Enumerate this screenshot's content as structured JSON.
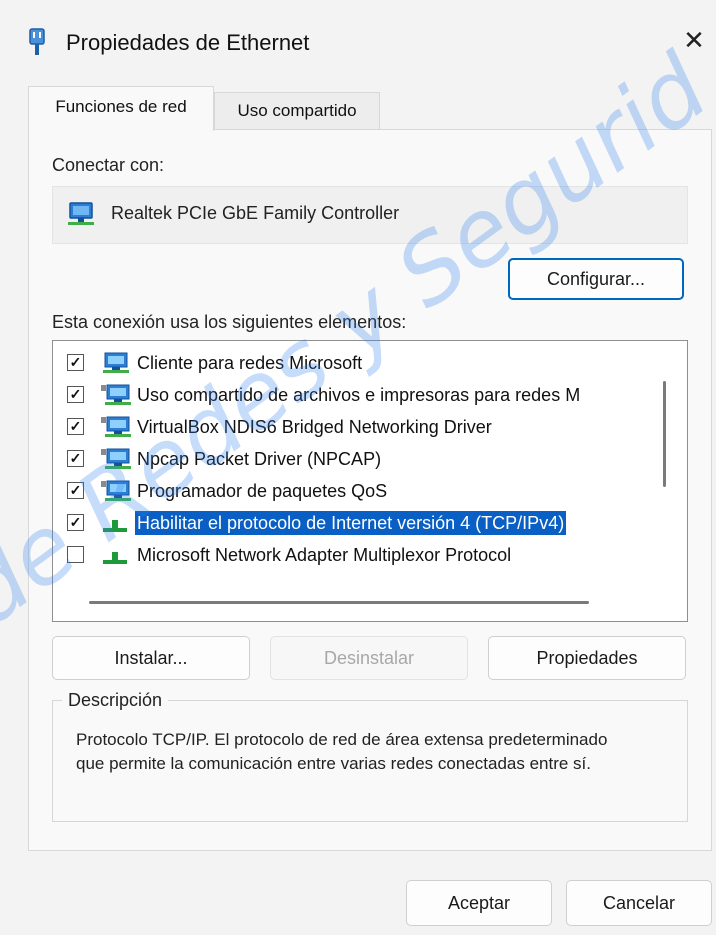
{
  "window": {
    "title": "Propiedades de Ethernet",
    "close_glyph": "✕"
  },
  "tabs": [
    {
      "label": "Funciones de red",
      "active": true
    },
    {
      "label": "Uso compartido",
      "active": false
    }
  ],
  "connect": {
    "label": "Conectar con:",
    "device_name": "Realtek PCIe GbE Family Controller",
    "device_icon": "network-adapter-icon"
  },
  "configure_button": "Configurar...",
  "items_label": "Esta conexión usa los siguientes elementos:",
  "items": [
    {
      "label": "Cliente para redes Microsoft",
      "checked": true,
      "icon": "network-client-icon",
      "selected": false
    },
    {
      "label": "Uso compartido de archivos e impresoras para redes M",
      "checked": true,
      "icon": "network-service-icon",
      "selected": false
    },
    {
      "label": "VirtualBox NDIS6 Bridged Networking Driver",
      "checked": true,
      "icon": "network-service-icon",
      "selected": false
    },
    {
      "label": "Npcap Packet Driver (NPCAP)",
      "checked": true,
      "icon": "network-service-icon",
      "selected": false
    },
    {
      "label": "Programador de paquetes QoS",
      "checked": true,
      "icon": "network-service-icon",
      "selected": false
    },
    {
      "label": "Habilitar el protocolo de Internet versión 4 (TCP/IPv4)",
      "checked": true,
      "icon": "protocol-icon",
      "selected": true
    },
    {
      "label": "Microsoft Network Adapter Multiplexor Protocol",
      "checked": false,
      "icon": "protocol-icon",
      "selected": false
    }
  ],
  "buttons": {
    "install": "Instalar...",
    "uninstall": "Desinstalar",
    "properties": "Propiedades"
  },
  "description": {
    "legend": "Descripción",
    "text": "Protocolo TCP/IP. El protocolo de red de área extensa predeterminado que permite la comunicación entre varias redes conectadas entre sí."
  },
  "footer": {
    "ok": "Aceptar",
    "cancel": "Cancelar"
  },
  "watermark": "de Redes y Segurid",
  "colors": {
    "accent": "#0067c0",
    "selection": "#0a5fc4",
    "watermark": "#3282f0"
  }
}
